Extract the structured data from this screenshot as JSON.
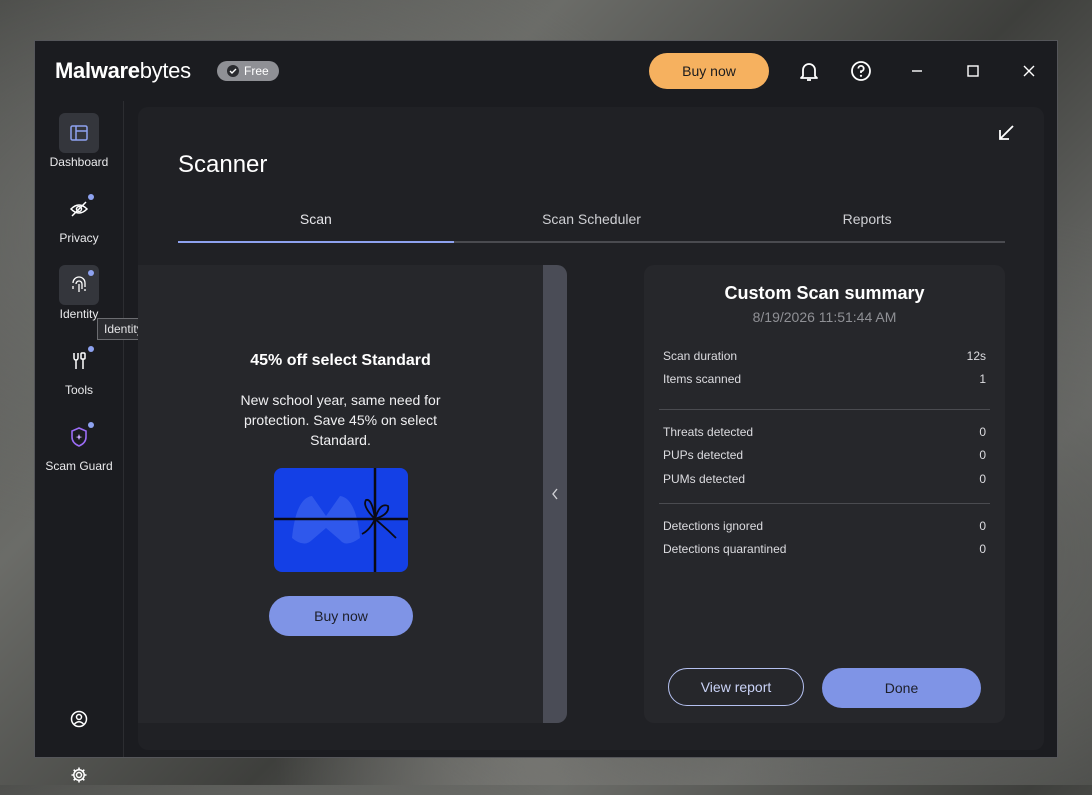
{
  "app": {
    "logo_bold": "Malware",
    "logo_rest": "bytes",
    "plan_badge": "Free",
    "buy_button": "Buy now"
  },
  "sidebar": {
    "items": [
      {
        "label": "Dashboard",
        "icon": "dashboard-icon"
      },
      {
        "label": "Privacy",
        "icon": "eye-slash-icon"
      },
      {
        "label": "Identity",
        "icon": "fingerprint-icon"
      },
      {
        "label": "Tools",
        "icon": "tools-icon"
      },
      {
        "label": "Scam Guard",
        "icon": "shield-icon"
      }
    ],
    "tooltip": "Identity Protection"
  },
  "main": {
    "title": "Scanner",
    "tabs": [
      {
        "label": "Scan"
      },
      {
        "label": "Scan Scheduler"
      },
      {
        "label": "Reports"
      }
    ]
  },
  "promo": {
    "title": "45% off select Standard",
    "body": "New school year, same need for protection. Save 45% on select Standard.",
    "button": "Buy now"
  },
  "summary": {
    "title": "Custom Scan summary",
    "date": "8/19/2026 11:51:44 AM",
    "rows": [
      {
        "label": "Scan duration",
        "value": "12s"
      },
      {
        "label": "Items scanned",
        "value": "1"
      },
      {
        "label": "Threats detected",
        "value": "0"
      },
      {
        "label": "PUPs detected",
        "value": "0"
      },
      {
        "label": "PUMs detected",
        "value": "0"
      },
      {
        "label": "Detections ignored",
        "value": "0"
      },
      {
        "label": "Detections quarantined",
        "value": "0"
      }
    ],
    "view_report": "View report",
    "done": "Done"
  },
  "colors": {
    "accent": "#8ea2f0",
    "buy": "#f6b15f",
    "primary_button": "#7f94e6",
    "gift": "#1440e6"
  }
}
